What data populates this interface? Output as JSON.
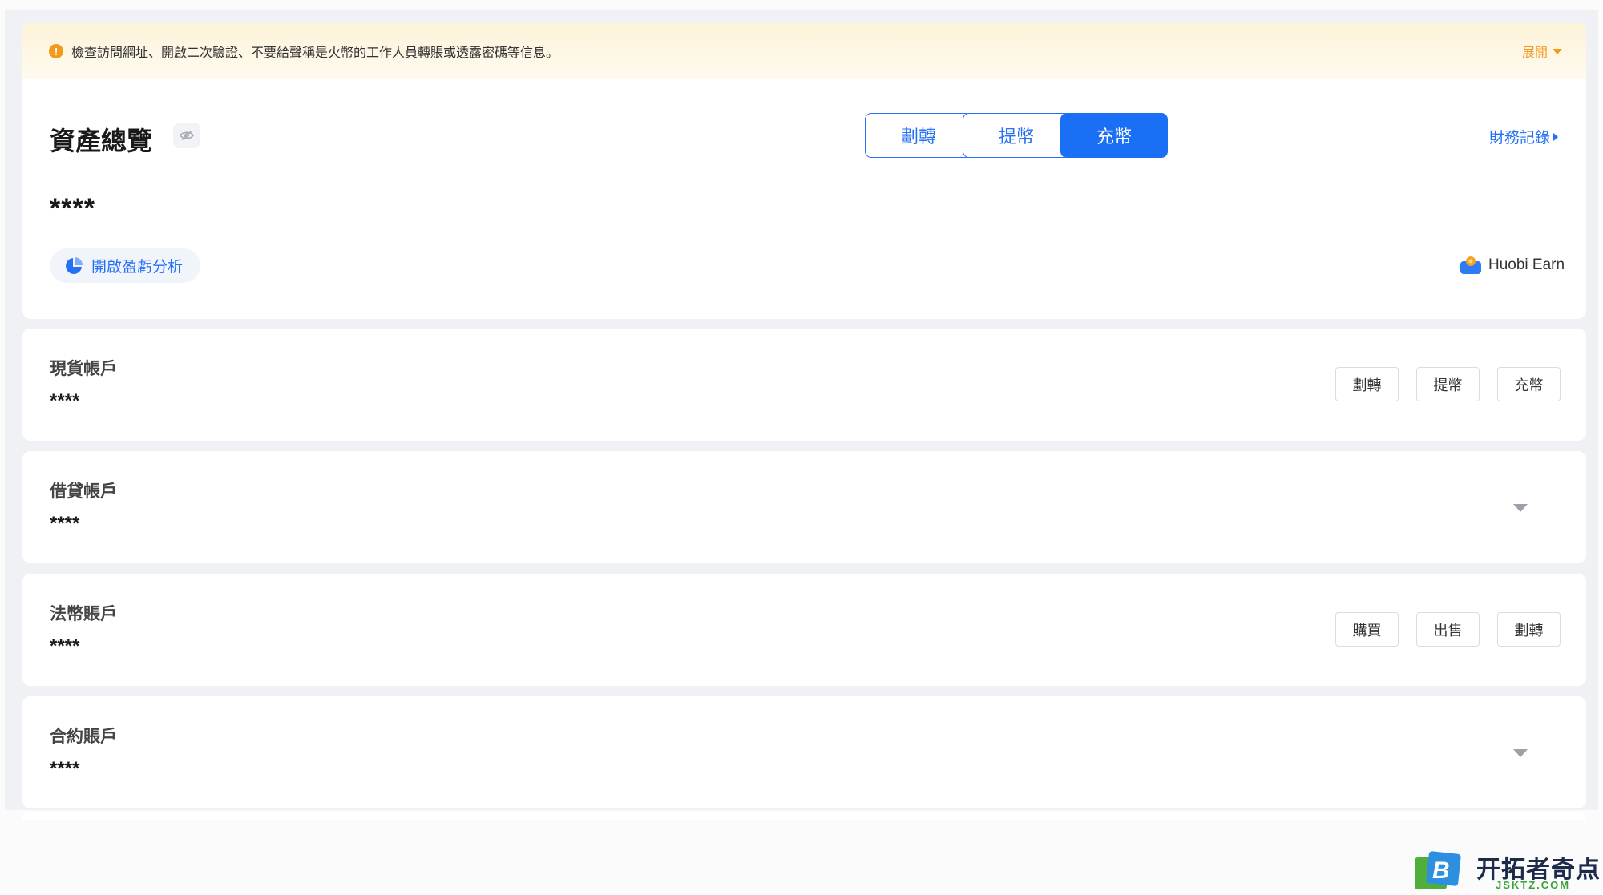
{
  "notice": {
    "message": "檢查訪問網址、開啟二次驗證、不要給聲稱是火幣的工作人員轉賬或透露密碼等信息。",
    "expand_label": "展開"
  },
  "overview": {
    "title": "資產總覽",
    "transfer_label": "劃轉",
    "withdraw_label": "提幣",
    "deposit_label": "充幣",
    "records_label": "財務記錄",
    "total_masked": "****",
    "pnl_label": "開啟盈虧分析",
    "earn_label": "Huobi Earn"
  },
  "accounts": [
    {
      "name": "現貨帳戶",
      "value": "****",
      "buttons": [
        "劃轉",
        "提幣",
        "充幣"
      ]
    },
    {
      "name": "借貸帳戶",
      "value": "****"
    },
    {
      "name": "法幣賬戶",
      "value": "****",
      "buttons": [
        "購買",
        "出售",
        "劃轉"
      ]
    },
    {
      "name": "合約賬戶",
      "value": "****"
    }
  ],
  "watermark": {
    "name": "开拓者奇点",
    "domain": "JSKTZ.COM"
  },
  "colors": {
    "accent": "#1a6ff4",
    "warning": "#f19a1c",
    "background": "#eff1f5"
  }
}
